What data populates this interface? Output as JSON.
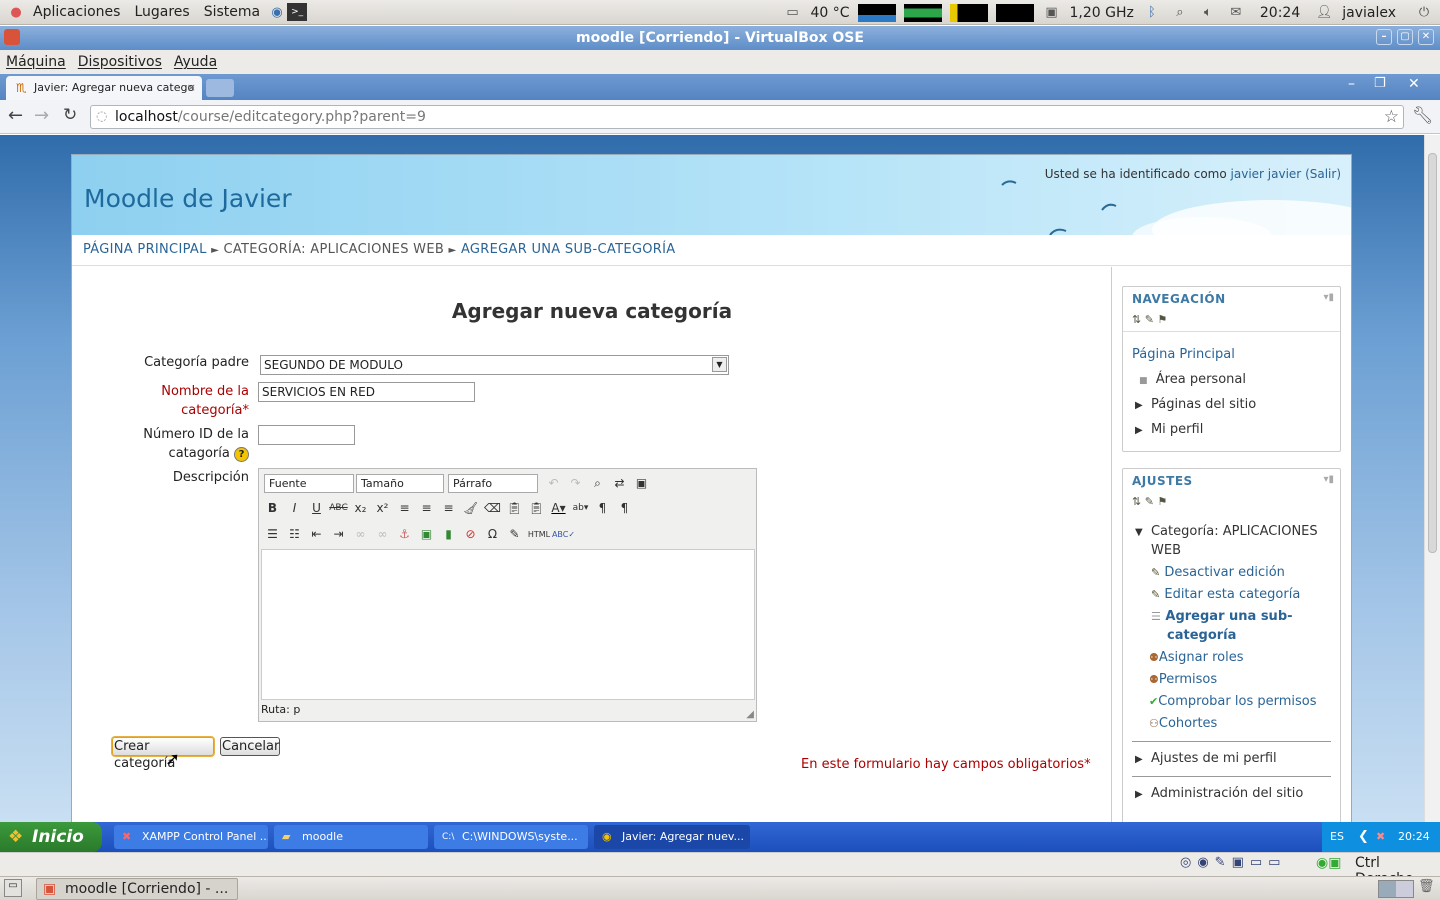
{
  "top_panel": {
    "menus": [
      "Aplicaciones",
      "Lugares",
      "Sistema"
    ],
    "temperature": "40 °C",
    "cpu_freq": "1,20 GHz",
    "clock": "20:24",
    "user": "javialex"
  },
  "vbox": {
    "window_title": "moodle [Corriendo] - VirtualBox OSE",
    "menus": [
      "Máquina",
      "Dispositivos",
      "Ayuda"
    ],
    "status_host_key": "Ctrl Derecho"
  },
  "browser": {
    "tab_title": "Javier: Agregar nueva catego",
    "url_host": "localhost",
    "url_path": "/course/editcategory.php?parent=9"
  },
  "page": {
    "site_title": "Moodle de Javier",
    "login_prefix": "Usted se ha identificado como ",
    "login_user": "javier javier",
    "logout": "(Salir)",
    "breadcrumb": [
      "PÁGINA PRINCIPAL",
      "CATEGORÍA: APLICACIONES WEB",
      "AGREGAR UNA SUB-CATEGORÍA"
    ],
    "breadcrumb_sep": "►",
    "form_title": "Agregar nueva categoría",
    "parent_label": "Categoría padre",
    "parent_value": "SEGUNDO DE MODULO",
    "name_label_1": "Nombre de la",
    "name_label_2": "categoría",
    "name_value": "SERVICIOS EN RED",
    "idnumber_label_1": "Número ID de la",
    "idnumber_label_2": "catagoría",
    "idnumber_value": "",
    "description_label": "Descripción",
    "editor_font": "Fuente",
    "editor_size": "Tamaño",
    "editor_format": "Párrafo",
    "editor_path": "Ruta: p",
    "submit_label": "Crear categoría",
    "cancel_label": "Cancelar",
    "required_note": "En este formulario hay campos obligatorios"
  },
  "nav_block": {
    "title": "NAVEGACIÓN",
    "items": [
      "Página Principal",
      "Área personal",
      "Páginas del sitio",
      "Mi perfil"
    ]
  },
  "settings_block": {
    "title": "AJUSTES",
    "category_1": "Categoría: APLICACIONES",
    "category_2": "WEB",
    "items": [
      "Desactivar edición",
      "Editar esta categoría"
    ],
    "active_1": "Agregar una sub-",
    "active_2": "categoría",
    "items2": [
      "Asignar roles",
      "Permisos",
      "Comprobar los permisos",
      "Cohortes"
    ],
    "profile": "Ajustes de mi perfil",
    "admin": "Administración del sitio"
  },
  "xp_taskbar": {
    "start": "Inicio",
    "tasks": [
      "XAMPP Control Panel ...",
      "moodle",
      "C:\\WINDOWS\\syste...",
      "Javier: Agregar nuev..."
    ],
    "lang": "ES",
    "clock": "20:24"
  },
  "gnome_bottom": {
    "task": "moodle [Corriendo] - ..."
  },
  "colors": {
    "brand": "#1e6a9c",
    "required": "#aa0000",
    "link": "#2a6496"
  }
}
